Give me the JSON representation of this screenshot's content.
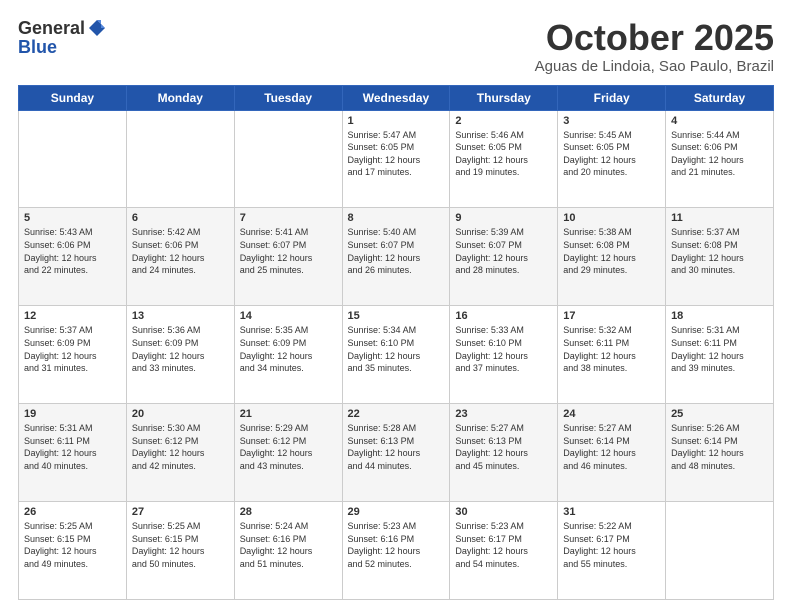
{
  "header": {
    "logo_line1": "General",
    "logo_line2": "Blue",
    "title": "October 2025",
    "location": "Aguas de Lindoia, Sao Paulo, Brazil"
  },
  "weekdays": [
    "Sunday",
    "Monday",
    "Tuesday",
    "Wednesday",
    "Thursday",
    "Friday",
    "Saturday"
  ],
  "weeks": [
    [
      {
        "day": "",
        "info": ""
      },
      {
        "day": "",
        "info": ""
      },
      {
        "day": "",
        "info": ""
      },
      {
        "day": "1",
        "info": "Sunrise: 5:47 AM\nSunset: 6:05 PM\nDaylight: 12 hours\nand 17 minutes."
      },
      {
        "day": "2",
        "info": "Sunrise: 5:46 AM\nSunset: 6:05 PM\nDaylight: 12 hours\nand 19 minutes."
      },
      {
        "day": "3",
        "info": "Sunrise: 5:45 AM\nSunset: 6:05 PM\nDaylight: 12 hours\nand 20 minutes."
      },
      {
        "day": "4",
        "info": "Sunrise: 5:44 AM\nSunset: 6:06 PM\nDaylight: 12 hours\nand 21 minutes."
      }
    ],
    [
      {
        "day": "5",
        "info": "Sunrise: 5:43 AM\nSunset: 6:06 PM\nDaylight: 12 hours\nand 22 minutes."
      },
      {
        "day": "6",
        "info": "Sunrise: 5:42 AM\nSunset: 6:06 PM\nDaylight: 12 hours\nand 24 minutes."
      },
      {
        "day": "7",
        "info": "Sunrise: 5:41 AM\nSunset: 6:07 PM\nDaylight: 12 hours\nand 25 minutes."
      },
      {
        "day": "8",
        "info": "Sunrise: 5:40 AM\nSunset: 6:07 PM\nDaylight: 12 hours\nand 26 minutes."
      },
      {
        "day": "9",
        "info": "Sunrise: 5:39 AM\nSunset: 6:07 PM\nDaylight: 12 hours\nand 28 minutes."
      },
      {
        "day": "10",
        "info": "Sunrise: 5:38 AM\nSunset: 6:08 PM\nDaylight: 12 hours\nand 29 minutes."
      },
      {
        "day": "11",
        "info": "Sunrise: 5:37 AM\nSunset: 6:08 PM\nDaylight: 12 hours\nand 30 minutes."
      }
    ],
    [
      {
        "day": "12",
        "info": "Sunrise: 5:37 AM\nSunset: 6:09 PM\nDaylight: 12 hours\nand 31 minutes."
      },
      {
        "day": "13",
        "info": "Sunrise: 5:36 AM\nSunset: 6:09 PM\nDaylight: 12 hours\nand 33 minutes."
      },
      {
        "day": "14",
        "info": "Sunrise: 5:35 AM\nSunset: 6:09 PM\nDaylight: 12 hours\nand 34 minutes."
      },
      {
        "day": "15",
        "info": "Sunrise: 5:34 AM\nSunset: 6:10 PM\nDaylight: 12 hours\nand 35 minutes."
      },
      {
        "day": "16",
        "info": "Sunrise: 5:33 AM\nSunset: 6:10 PM\nDaylight: 12 hours\nand 37 minutes."
      },
      {
        "day": "17",
        "info": "Sunrise: 5:32 AM\nSunset: 6:11 PM\nDaylight: 12 hours\nand 38 minutes."
      },
      {
        "day": "18",
        "info": "Sunrise: 5:31 AM\nSunset: 6:11 PM\nDaylight: 12 hours\nand 39 minutes."
      }
    ],
    [
      {
        "day": "19",
        "info": "Sunrise: 5:31 AM\nSunset: 6:11 PM\nDaylight: 12 hours\nand 40 minutes."
      },
      {
        "day": "20",
        "info": "Sunrise: 5:30 AM\nSunset: 6:12 PM\nDaylight: 12 hours\nand 42 minutes."
      },
      {
        "day": "21",
        "info": "Sunrise: 5:29 AM\nSunset: 6:12 PM\nDaylight: 12 hours\nand 43 minutes."
      },
      {
        "day": "22",
        "info": "Sunrise: 5:28 AM\nSunset: 6:13 PM\nDaylight: 12 hours\nand 44 minutes."
      },
      {
        "day": "23",
        "info": "Sunrise: 5:27 AM\nSunset: 6:13 PM\nDaylight: 12 hours\nand 45 minutes."
      },
      {
        "day": "24",
        "info": "Sunrise: 5:27 AM\nSunset: 6:14 PM\nDaylight: 12 hours\nand 46 minutes."
      },
      {
        "day": "25",
        "info": "Sunrise: 5:26 AM\nSunset: 6:14 PM\nDaylight: 12 hours\nand 48 minutes."
      }
    ],
    [
      {
        "day": "26",
        "info": "Sunrise: 5:25 AM\nSunset: 6:15 PM\nDaylight: 12 hours\nand 49 minutes."
      },
      {
        "day": "27",
        "info": "Sunrise: 5:25 AM\nSunset: 6:15 PM\nDaylight: 12 hours\nand 50 minutes."
      },
      {
        "day": "28",
        "info": "Sunrise: 5:24 AM\nSunset: 6:16 PM\nDaylight: 12 hours\nand 51 minutes."
      },
      {
        "day": "29",
        "info": "Sunrise: 5:23 AM\nSunset: 6:16 PM\nDaylight: 12 hours\nand 52 minutes."
      },
      {
        "day": "30",
        "info": "Sunrise: 5:23 AM\nSunset: 6:17 PM\nDaylight: 12 hours\nand 54 minutes."
      },
      {
        "day": "31",
        "info": "Sunrise: 5:22 AM\nSunset: 6:17 PM\nDaylight: 12 hours\nand 55 minutes."
      },
      {
        "day": "",
        "info": ""
      }
    ]
  ]
}
